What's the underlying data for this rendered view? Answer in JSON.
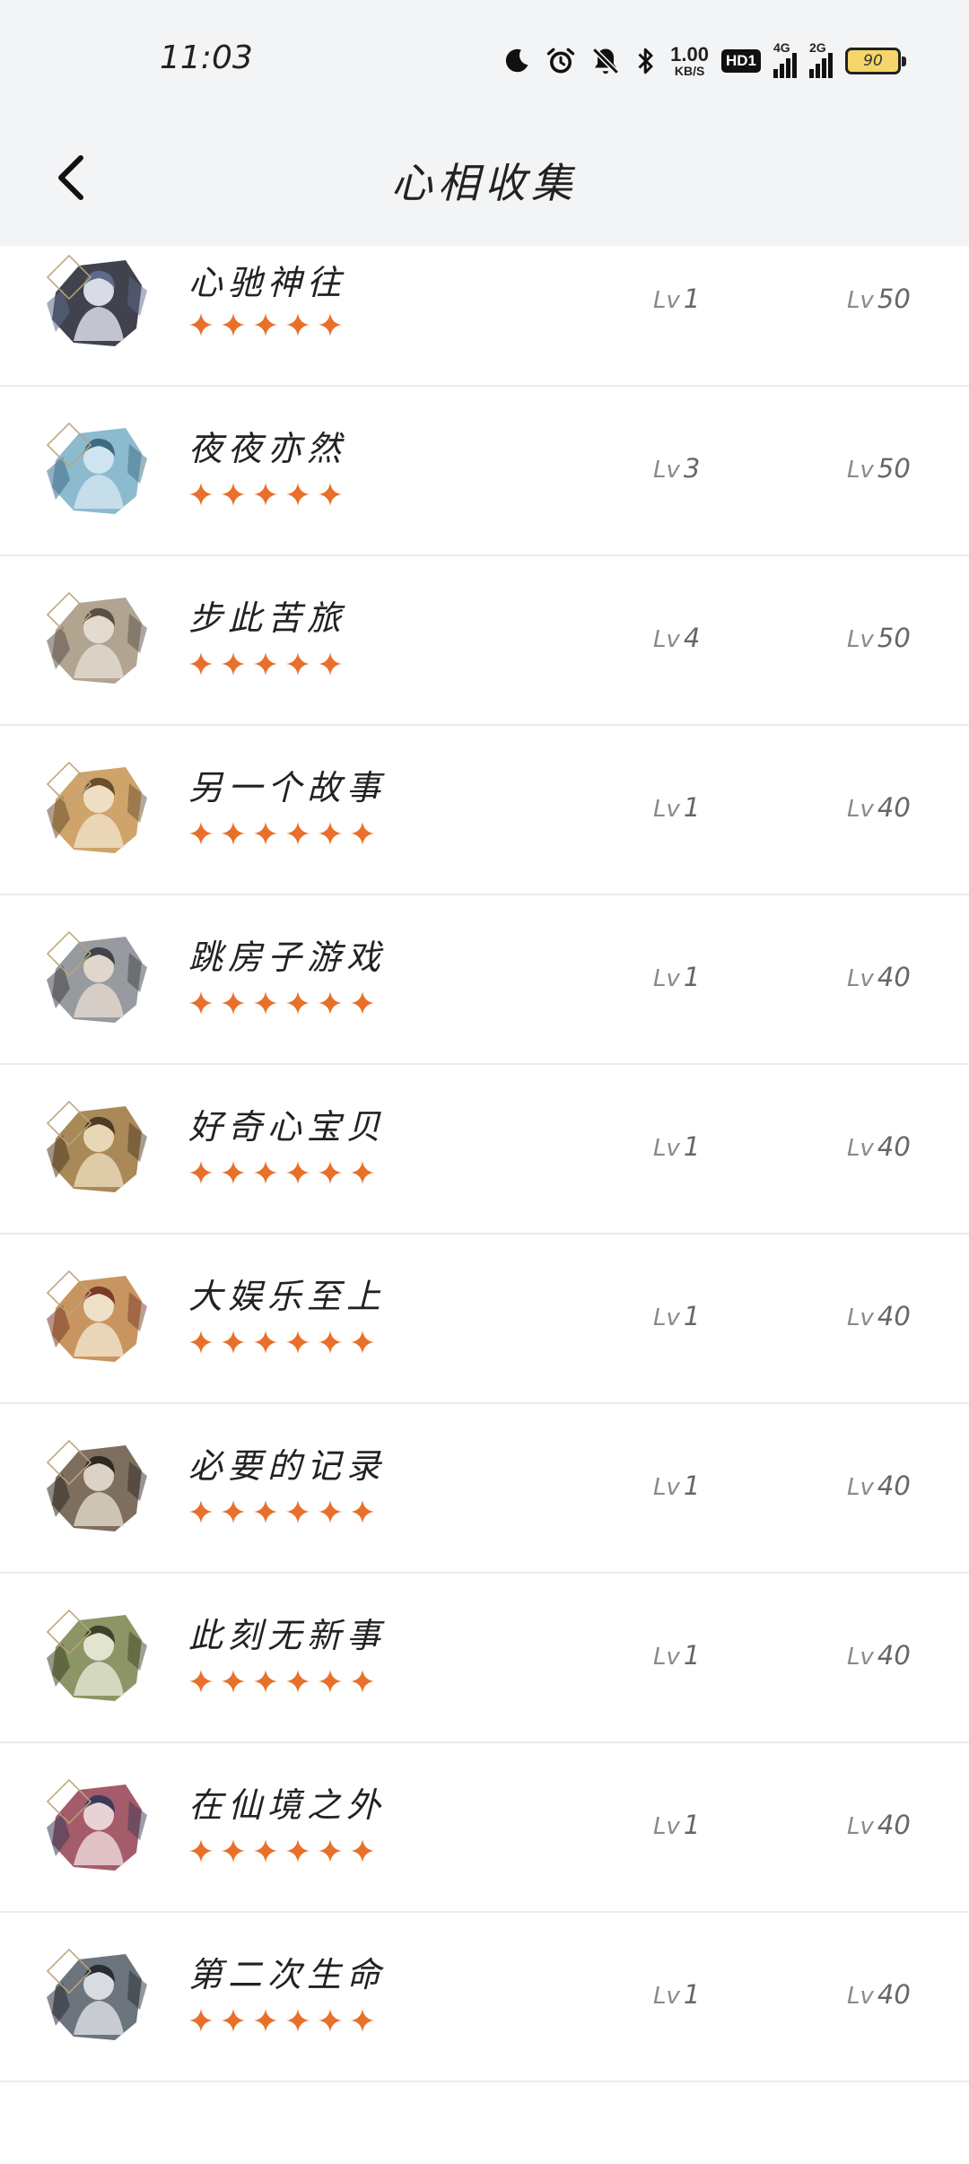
{
  "status_bar": {
    "time": "11:03",
    "net_speed_value": "1.00",
    "net_speed_unit": "KB/S",
    "hd_badge": "HD1",
    "signal_1_label": "4G",
    "signal_2_label": "2G",
    "battery": "90",
    "icons": [
      "moon-icon",
      "alarm-icon",
      "mute-icon",
      "bluetooth-icon"
    ]
  },
  "header": {
    "back_icon": "chevron-left-icon",
    "title": "心相收集"
  },
  "level_prefix": "Lv",
  "star_color": "#e8702a",
  "items": [
    {
      "name": "心驰神往",
      "stars": 5,
      "level": "1",
      "max_level": "50",
      "avatar_colors": [
        "#2b2f3a",
        "#d9dce6",
        "#5d6a8a"
      ]
    },
    {
      "name": "夜夜亦然",
      "stars": 5,
      "level": "3",
      "max_level": "50",
      "avatar_colors": [
        "#7fb2c9",
        "#cfe4ee",
        "#3d6b86"
      ]
    },
    {
      "name": "步此苦旅",
      "stars": 5,
      "level": "4",
      "max_level": "50",
      "avatar_colors": [
        "#a99a85",
        "#e3dbcf",
        "#5a5048"
      ]
    },
    {
      "name": "另一个故事",
      "stars": 6,
      "level": "1",
      "max_level": "40",
      "avatar_colors": [
        "#c99a5a",
        "#eedfc4",
        "#6b4e2e"
      ]
    },
    {
      "name": "跳房子游戏",
      "stars": 6,
      "level": "1",
      "max_level": "40",
      "avatar_colors": [
        "#8c8f93",
        "#e0d6cc",
        "#3f4246"
      ]
    },
    {
      "name": "好奇心宝贝",
      "stars": 6,
      "level": "1",
      "max_level": "40",
      "avatar_colors": [
        "#a07c45",
        "#e8d7b5",
        "#4f3a22"
      ]
    },
    {
      "name": "大娱乐至上",
      "stars": 6,
      "level": "1",
      "max_level": "40",
      "avatar_colors": [
        "#c28a4f",
        "#efe0c8",
        "#7a3b2a"
      ]
    },
    {
      "name": "必要的记录",
      "stars": 6,
      "level": "1",
      "max_level": "40",
      "avatar_colors": [
        "#6f5e4c",
        "#dcd3c6",
        "#2f2923"
      ]
    },
    {
      "name": "此刻无新事",
      "stars": 6,
      "level": "1",
      "max_level": "40",
      "avatar_colors": [
        "#7f8a55",
        "#e2e4cf",
        "#3d4426"
      ]
    },
    {
      "name": "在仙境之外",
      "stars": 6,
      "level": "1",
      "max_level": "40",
      "avatar_colors": [
        "#9b4a5a",
        "#e9d2d6",
        "#3d3a5a"
      ]
    },
    {
      "name": "第二次生命",
      "stars": 6,
      "level": "1",
      "max_level": "40",
      "avatar_colors": [
        "#5c6570",
        "#d8dbe0",
        "#2a2d33"
      ]
    }
  ]
}
